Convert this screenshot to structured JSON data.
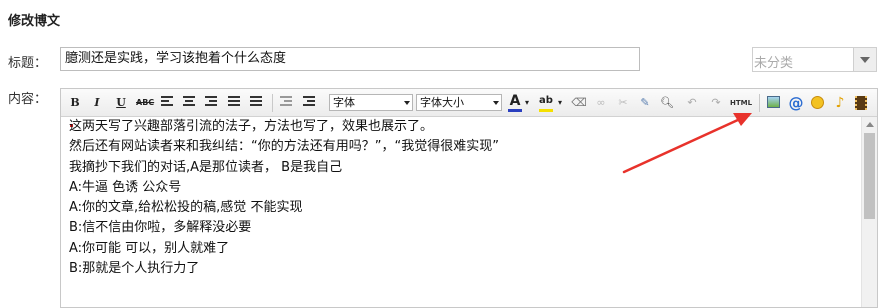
{
  "page": {
    "heading": "修改博文"
  },
  "form": {
    "title_label": "标题：",
    "title_value": "臆测还是实践，学习该抱着个什么态度",
    "category_value": "未分类",
    "content_label": "内容："
  },
  "toolbar": {
    "bold": "B",
    "italic": "I",
    "underline": "U",
    "strike": "ABC",
    "font_family": "字体",
    "font_size": "字体大小",
    "font_color": "A",
    "highlight": "ab",
    "html": "HTML",
    "at": "@"
  },
  "editor": {
    "lines": [
      "这两天写了兴趣部落引流的法子，方法也写了，效果也展示了。",
      "然后还有网站读者来和我纠结：“你的方法还有用吗？”，“我觉得很难实现”",
      "我摘抄下我们的对话,A是那位读者， B是我自己",
      "A:牛逼 色诱 公众号",
      "A:你的文章,给松松投的稿,感觉 不能实现",
      "B:信不信由你啦，多解释没必要",
      "A:你可能 可以，别人就难了",
      "B:那就是个人执行力了"
    ]
  },
  "colors": {
    "annotation_arrow": "#e8322b",
    "text_color_bar": "#2a3fbf",
    "highlight_bar": "#f5e000"
  }
}
